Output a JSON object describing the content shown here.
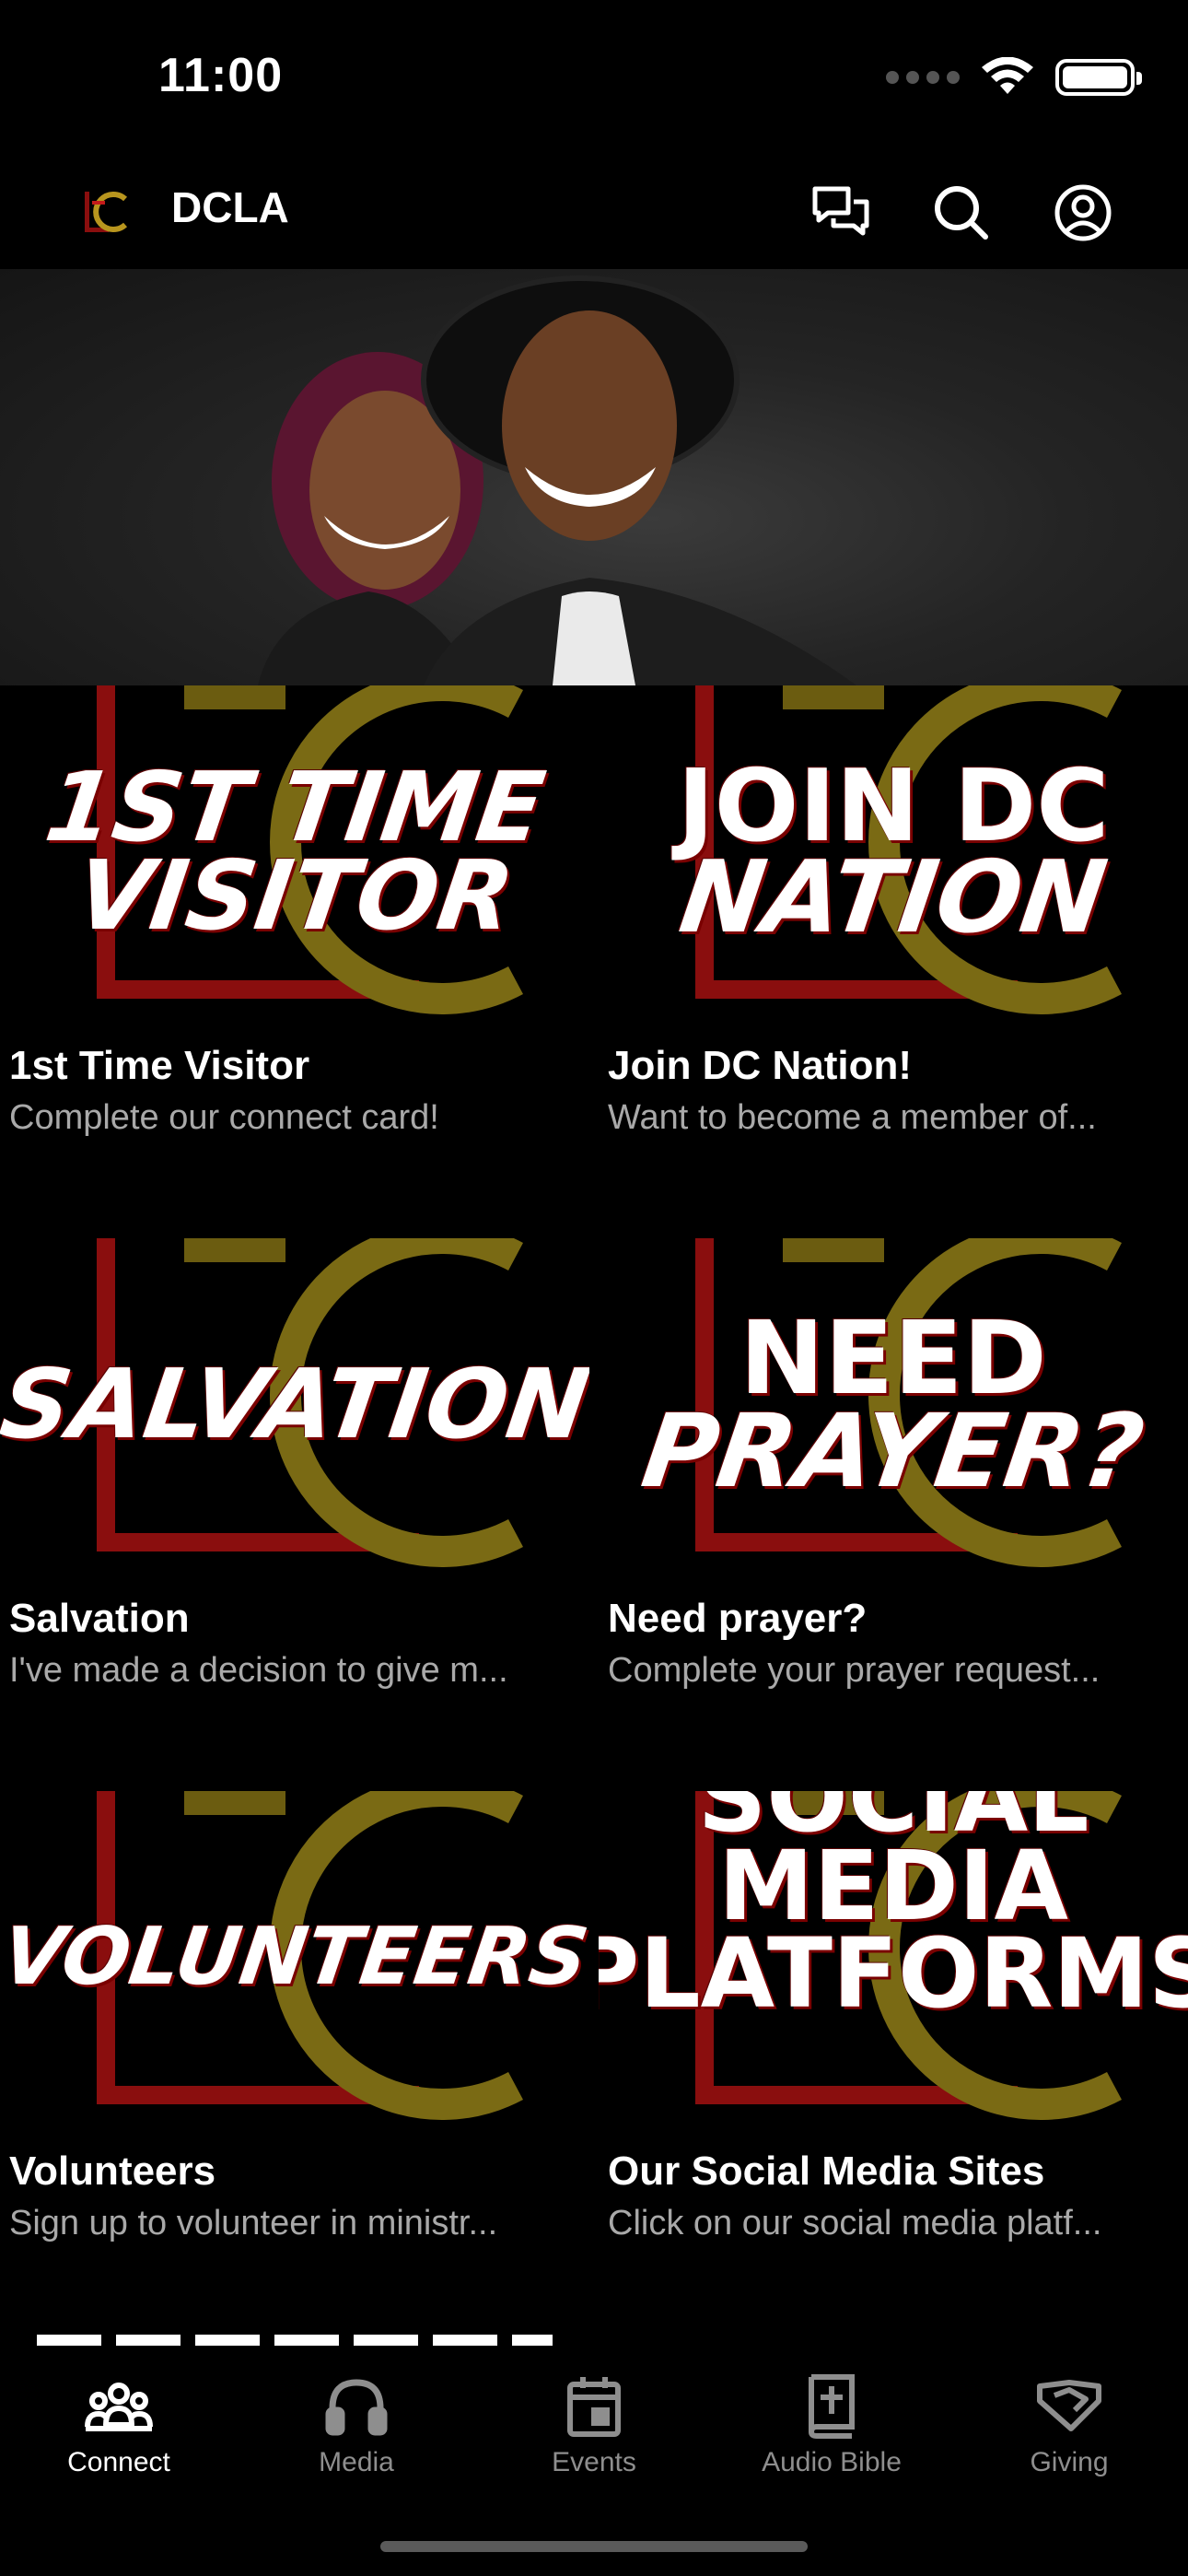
{
  "status_bar": {
    "time": "11:00"
  },
  "header": {
    "title": "DCLA"
  },
  "tiles": [
    {
      "title": "1st Time Visitor",
      "subtitle": "Complete our connect card!",
      "image_lines": [
        "1ST TIME",
        "VISITOR"
      ]
    },
    {
      "title": "Join DC Nation!",
      "subtitle": "Want to become a member of...",
      "image_lines": [
        "JOIN DC",
        "NATION"
      ]
    },
    {
      "title": "Salvation",
      "subtitle": "I've made a decision to give m...",
      "image_lines": [
        "SALVATION"
      ]
    },
    {
      "title": "Need prayer?",
      "subtitle": "Complete your prayer request...",
      "image_lines": [
        "NEED",
        "PRAYER?"
      ]
    },
    {
      "title": "Volunteers",
      "subtitle": "Sign up to volunteer in ministr...",
      "image_lines": [
        "VOLUNTEERS"
      ]
    },
    {
      "title": "Our Social Media Sites",
      "subtitle": "Click on our social media platf...",
      "image_lines": [
        "SOCIAL",
        "MEDIA",
        "PLATFORMS"
      ]
    }
  ],
  "tab_bar": {
    "items": [
      {
        "label": "Connect",
        "icon": "people-icon",
        "active": true
      },
      {
        "label": "Media",
        "icon": "headphones-icon",
        "active": false
      },
      {
        "label": "Events",
        "icon": "calendar-icon",
        "active": false
      },
      {
        "label": "Audio Bible",
        "icon": "bible-plus-icon",
        "active": false
      },
      {
        "label": "Giving",
        "icon": "handshake-heart-icon",
        "active": false
      }
    ]
  },
  "colors": {
    "background": "#000000",
    "subtitle": "#a9a9a9",
    "tab_inactive": "#8e8e8e",
    "logo_gold": "#7a6a14",
    "logo_red": "#8a0e0e"
  }
}
